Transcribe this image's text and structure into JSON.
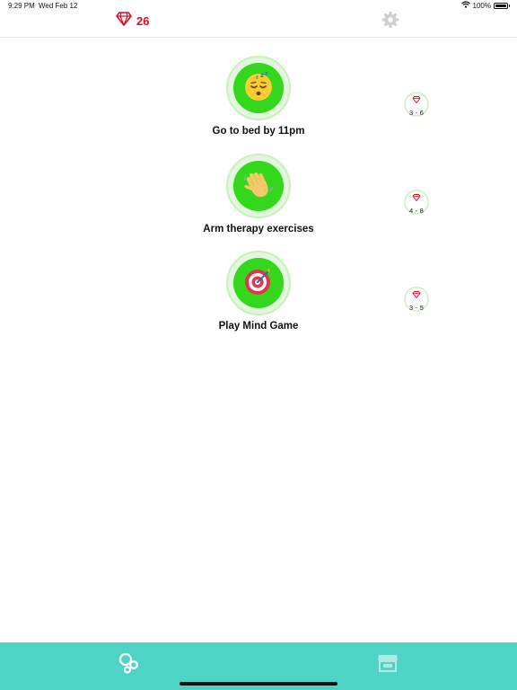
{
  "status_bar": {
    "time": "9:29 PM",
    "date": "Wed Feb 12",
    "battery": "100%",
    "battery_level": 1.0,
    "icons": [
      "wifi-icon",
      "battery-icon"
    ]
  },
  "header": {
    "gem_count": "26",
    "gem_icon": "gem-icon",
    "settings_icon": "gear-icon"
  },
  "habits": [
    {
      "title": "Go to bed by 11pm",
      "icon": "sleeping-face-icon",
      "reward_range": "3 - 6"
    },
    {
      "title": "Arm therapy exercises",
      "icon": "waving-hand-icon",
      "reward_range": "4 - 8"
    },
    {
      "title": "Play Mind Game",
      "icon": "target-icon",
      "reward_range": "3 - 5"
    }
  ],
  "tab_bar": {
    "tabs": [
      {
        "name": "home",
        "icon": "bubbles-icon"
      },
      {
        "name": "store",
        "icon": "store-icon"
      }
    ]
  },
  "colors": {
    "accent_green": "#33d71c",
    "gem_red": "#d0112b",
    "tab_bar_teal": "#4fd3c4"
  }
}
